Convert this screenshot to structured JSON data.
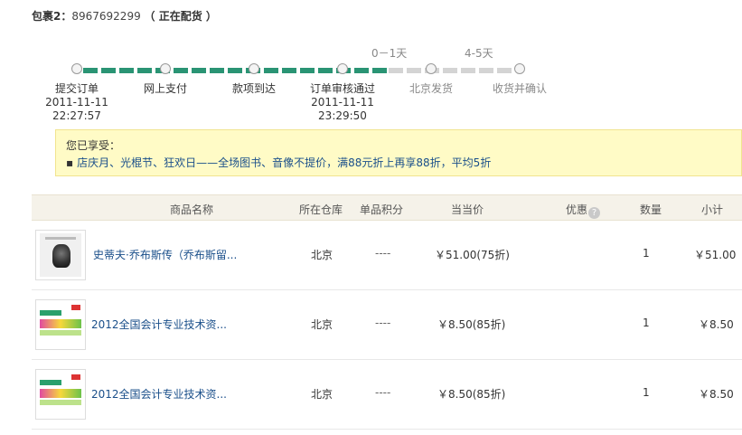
{
  "package": {
    "label": "包裹2：",
    "number": "8967692299",
    "status": "（ 正在配货 ）"
  },
  "tracker": {
    "durations": [
      "0－1天",
      "4-5天"
    ],
    "steps": [
      {
        "label": "提交订单",
        "date": "2011-11-11",
        "time": "22:27:57"
      },
      {
        "label": "网上支付"
      },
      {
        "label": "款项到达"
      },
      {
        "label": "订单审核通过",
        "date": "2011-11-11",
        "time": "23:29:50"
      },
      {
        "label": "北京发货"
      },
      {
        "label": "收货并确认"
      }
    ],
    "colors": {
      "done": "#2a9474",
      "todo": "#d4d4d4"
    }
  },
  "promo": {
    "title": "您已享受：",
    "bullet": "▪",
    "item": "店庆月、光棍节、狂欢日——全场图书、音像不提价，满88元折上再享88折，平均5折"
  },
  "table": {
    "headers": {
      "name": "商品名称",
      "warehouse": "所在仓库",
      "points": "单品积分",
      "price": "当当价",
      "discount": "优惠",
      "qty": "数量",
      "subtotal": "小计"
    },
    "rows": [
      {
        "name": "史蒂夫·乔布斯传（乔布斯留...",
        "warehouse": "北京",
        "points": "----",
        "price": "￥51.00(75折)",
        "qty": "1",
        "subtotal": "￥51.00",
        "thumb": "book-cover-jobs"
      },
      {
        "name": "2012全国会计专业技术资...",
        "warehouse": "北京",
        "points": "----",
        "price": "￥8.50(85折)",
        "qty": "1",
        "subtotal": "￥8.50",
        "thumb": "book-cover-accounting"
      },
      {
        "name": "2012全国会计专业技术资...",
        "warehouse": "北京",
        "points": "----",
        "price": "￥8.50(85折)",
        "qty": "1",
        "subtotal": "￥8.50",
        "thumb": "book-cover-accounting"
      }
    ]
  }
}
